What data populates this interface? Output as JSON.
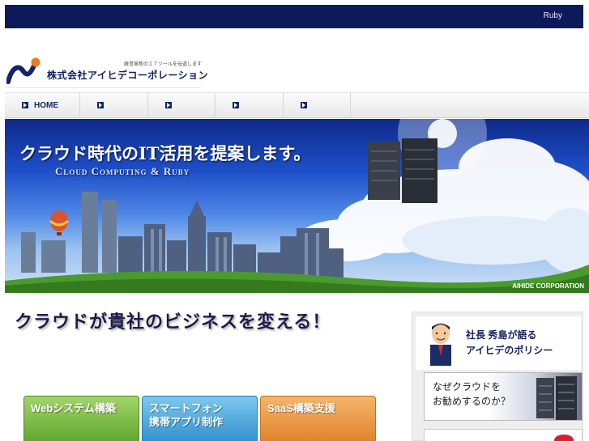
{
  "topbar": {
    "link_label": "Ruby"
  },
  "logo": {
    "tagline": "経営革新のＩＴツールを伝道します",
    "company_name": "株式会社アイヒデコーポレーション"
  },
  "nav": {
    "items": [
      {
        "label": "HOME"
      },
      {
        "label": ""
      },
      {
        "label": ""
      },
      {
        "label": ""
      },
      {
        "label": ""
      }
    ]
  },
  "hero": {
    "headline": "クラウド時代のIT活用を提案します。",
    "subline": "Cloud Computing & Ruby",
    "corp": "AIHIDE CORPORATION"
  },
  "main": {
    "heading": "クラウドが貴社のビジネスを変える！"
  },
  "services": [
    {
      "line1": "Webシステム構築",
      "line2": ""
    },
    {
      "line1": "スマートフォン",
      "line2": "携帯アプリ制作"
    },
    {
      "line1": "SaaS構築支援",
      "line2": ""
    }
  ],
  "sidebar": {
    "ceo_line1": "社長 秀島が語る",
    "ceo_line2": "アイヒデのポリシー",
    "why_line1": "なぜクラウドを",
    "why_line2": "お勧めするのか？"
  },
  "colors": {
    "topbar": "#0c1a5a",
    "nav_text": "#13265e",
    "svc_green": "#5fa52c",
    "svc_blue": "#2f8fcb",
    "svc_orange": "#e0812a"
  }
}
